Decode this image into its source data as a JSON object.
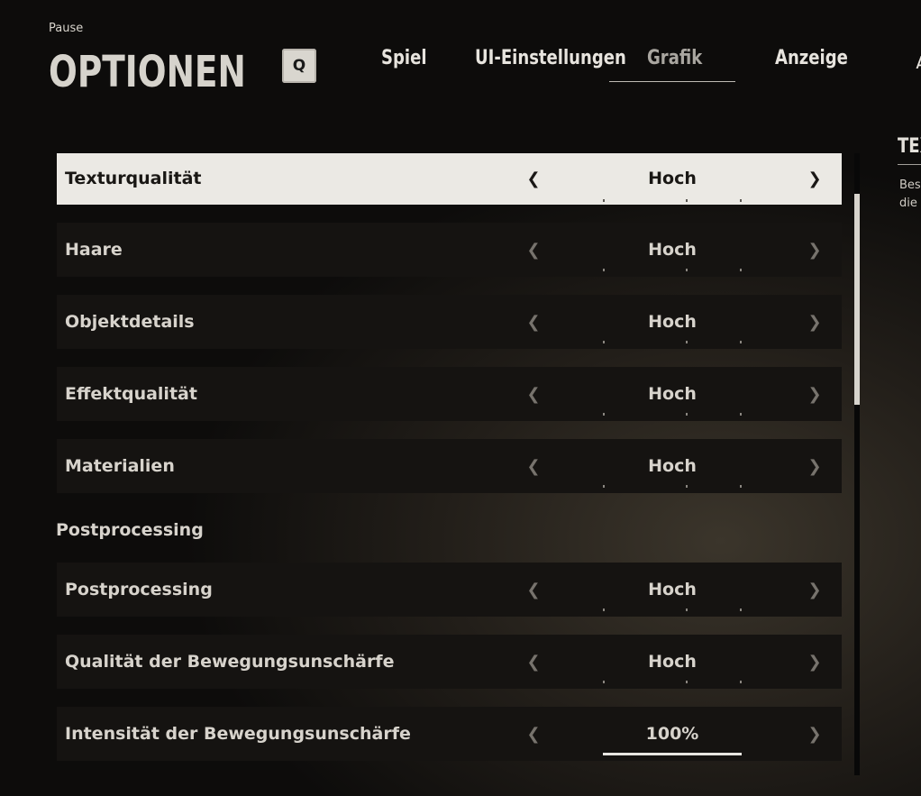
{
  "header": {
    "context": "Pause",
    "title": "OPTIONEN",
    "tab_key": "Q",
    "tabs": [
      {
        "label": "Spiel",
        "active": false
      },
      {
        "label": "UI-Einstellungen",
        "active": false
      },
      {
        "label": "Grafik",
        "active": true
      },
      {
        "label": "Anzeige",
        "active": false
      }
    ],
    "next_tab_peek": "A"
  },
  "settings": [
    {
      "label": "Texturqualität",
      "value": "Hoch",
      "selected": true
    },
    {
      "label": "Haare",
      "value": "Hoch",
      "selected": false
    },
    {
      "label": "Objektdetails",
      "value": "Hoch",
      "selected": false
    },
    {
      "label": "Effektqualität",
      "value": "Hoch",
      "selected": false
    },
    {
      "label": "Materialien",
      "value": "Hoch",
      "selected": false
    }
  ],
  "section_title": "Postprocessing",
  "post_settings": [
    {
      "label": "Postprocessing",
      "value": "Hoch"
    },
    {
      "label": "Qualität der Bewegungsunschärfe",
      "value": "Hoch"
    },
    {
      "label": "Intensität der Bewegungsunschärfe",
      "value": "100%",
      "fill_fraction": 1.0
    }
  ],
  "side_panel": {
    "title": "TEX",
    "text_line1": "Bes",
    "text_line2": "die"
  },
  "icons": {
    "prev": "chevron-left-icon",
    "next": "chevron-right-icon"
  },
  "colors": {
    "selected_row_bg": "#ebe9e4",
    "row_bg": "#151311",
    "accent_text": "#d7d3cc"
  }
}
